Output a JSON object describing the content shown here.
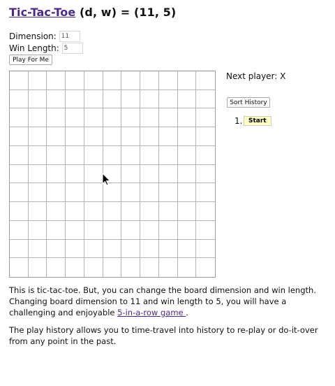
{
  "header": {
    "title_link": "Tic-Tac-Toe",
    "title_rest": " (d, w) = (11, 5)"
  },
  "settings": {
    "dimension_label": "Dimension:",
    "dimension_value": "11",
    "win_length_label": "Win Length:",
    "win_length_value": "5",
    "play_button": "Play For Me"
  },
  "board": {
    "dimension": 11
  },
  "status": {
    "next_player": "Next player: X"
  },
  "history": {
    "sort_button": "Sort History",
    "items": [
      {
        "number": "1.",
        "label": "Start"
      }
    ]
  },
  "description": {
    "p1_text": "This is tic-tac-toe. But, you can change the board dimension and win length. Changing board dimension to 11 and win length to 5, you will have a challenging and enjoyable ",
    "p1_link": "5-in-a-row game ",
    "p1_end": ".",
    "p2": "The play history allows you to time-travel into history to re-play or do-it-over from any point in the past."
  }
}
